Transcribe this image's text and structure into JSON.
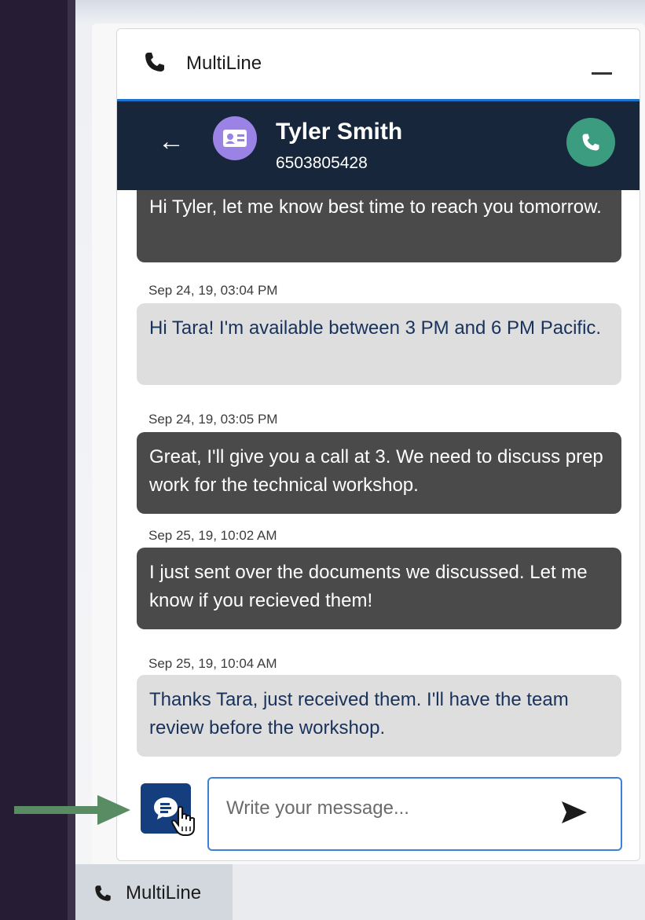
{
  "utility_panel": {
    "title": "MultiLine",
    "minimize_icon": "minimize-icon"
  },
  "contact": {
    "name": "Tyler Smith",
    "number": "6503805428",
    "avatar_icon": "contact-card-icon",
    "call_icon": "phone-icon"
  },
  "messages": [
    {
      "direction": "outgoing",
      "timestamp": "",
      "text": "Hi Tyler, let me know best time to reach you tomorrow."
    },
    {
      "direction": "incoming",
      "timestamp": "Sep 24, 19, 03:04 PM",
      "text": "Hi Tara! I'm available between 3 PM and 6 PM Pacific."
    },
    {
      "direction": "outgoing",
      "timestamp": "Sep 24, 19, 03:05 PM",
      "text": "Great, I'll give you a call at 3. We need to discuss prep work for the technical workshop."
    },
    {
      "direction": "outgoing",
      "timestamp": "Sep 25, 19, 10:02 AM",
      "text": "I just sent over the documents we discussed. Let me know if you recieved them!"
    },
    {
      "direction": "incoming",
      "timestamp": "Sep 25, 19, 10:04 AM",
      "text": "Thanks Tara, just received them. I'll have the team review before the workshop."
    }
  ],
  "composer": {
    "placeholder": "Write your message...",
    "templates_icon": "message-template-icon",
    "send_icon": "send-icon"
  },
  "utility_bar": {
    "tab_label": "MultiLine"
  },
  "colors": {
    "contact_bar": "#17263a",
    "accent": "#1b73d1",
    "call_button": "#3c9c7f",
    "avatar": "#9b83e6",
    "outgoing_bubble": "#4a4a4a",
    "incoming_bubble": "#dedede",
    "template_button": "#143e7e",
    "pointer_arrow": "#5a8c63"
  }
}
